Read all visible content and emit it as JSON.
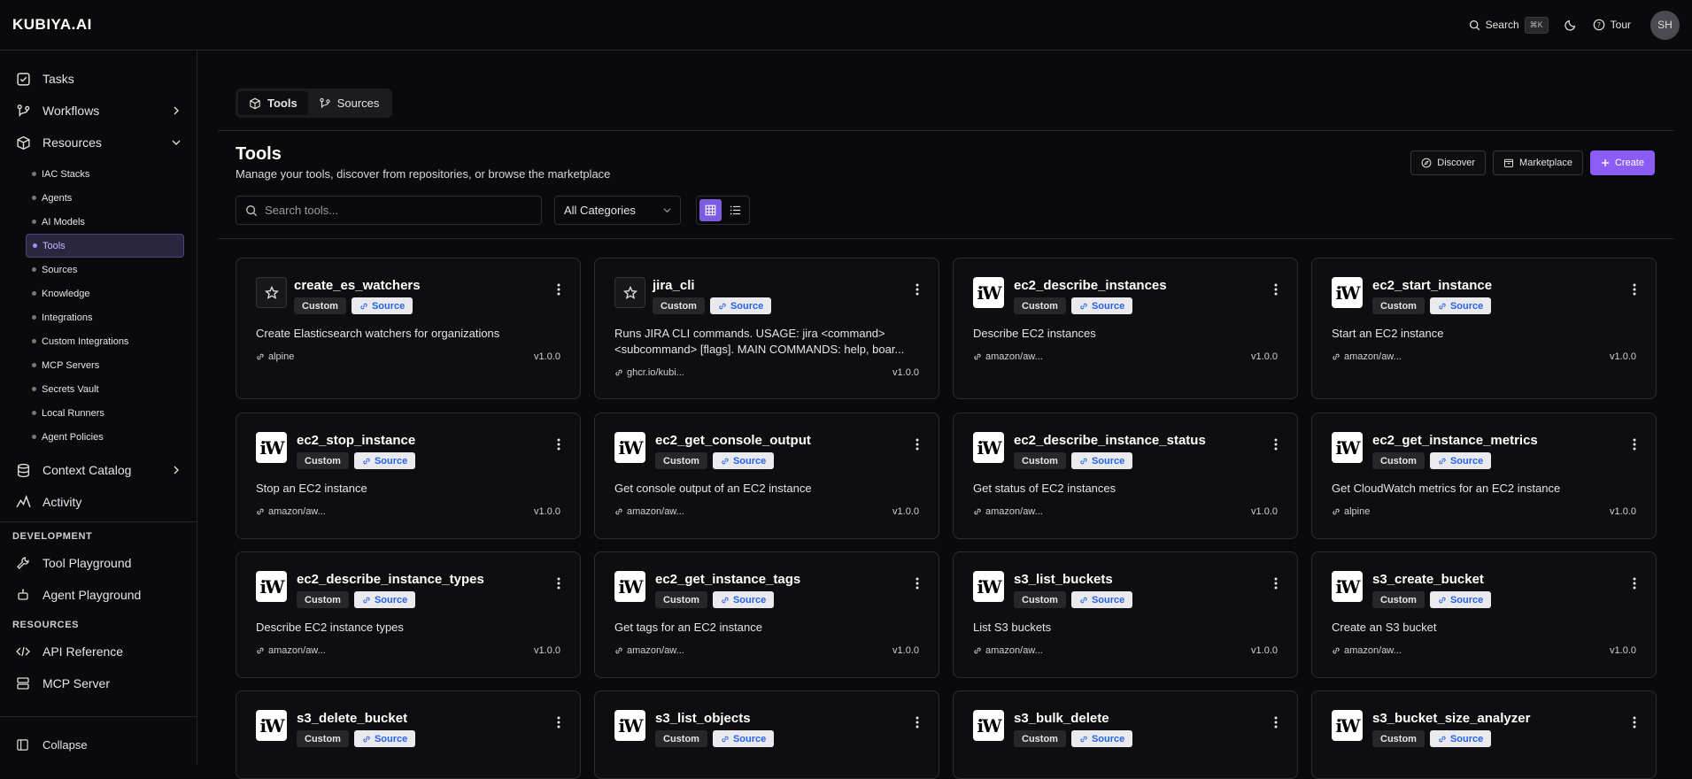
{
  "header": {
    "logo": "KUBIYA.AI",
    "search_label": "Search",
    "search_kbd": "⌘K",
    "tour_label": "Tour",
    "avatar": "SH"
  },
  "sidebar": {
    "tasks": "Tasks",
    "workflows": "Workflows",
    "resources": "Resources",
    "resource_items": [
      "IAC Stacks",
      "Agents",
      "AI Models",
      "Tools",
      "Sources",
      "Knowledge",
      "Integrations",
      "Custom Integrations",
      "MCP Servers",
      "Secrets Vault",
      "Local Runners",
      "Agent Policies"
    ],
    "context_catalog": "Context Catalog",
    "activity": "Activity",
    "dev_heading": "DEVELOPMENT",
    "tool_playground": "Tool Playground",
    "agent_playground": "Agent Playground",
    "res_heading": "RESOURCES",
    "api_reference": "API Reference",
    "mcp_server": "MCP Server",
    "collapse": "Collapse"
  },
  "main": {
    "tabs": {
      "tools": "Tools",
      "sources": "Sources"
    },
    "title": "Tools",
    "subtitle": "Manage your tools, discover from repositories, or browse the marketplace",
    "actions": {
      "discover": "Discover",
      "marketplace": "Marketplace",
      "create": "Create"
    },
    "search_placeholder": "Search tools...",
    "category": "All Categories"
  },
  "cards": [
    {
      "name": "create_es_watchers",
      "icon": "star-icon",
      "custom": "Custom",
      "source": "Source",
      "desc": "Create Elasticsearch watchers for organizations",
      "image": "alpine",
      "version": "v1.0.0"
    },
    {
      "name": "jira_cli",
      "icon": "star-icon",
      "custom": "Custom",
      "source": "Source",
      "desc": "Runs JIRA CLI commands. USAGE: jira <command> <subcommand> [flags]. MAIN COMMANDS: help, boar...",
      "image": "ghcr.io/kubi...",
      "version": "v1.0.0"
    },
    {
      "name": "ec2_describe_instances",
      "icon": "aws-icon",
      "custom": "Custom",
      "source": "Source",
      "desc": "Describe EC2 instances",
      "image": "amazon/aw...",
      "version": "v1.0.0"
    },
    {
      "name": "ec2_start_instance",
      "icon": "aws-icon",
      "custom": "Custom",
      "source": "Source",
      "desc": "Start an EC2 instance",
      "image": "amazon/aw...",
      "version": "v1.0.0"
    },
    {
      "name": "ec2_stop_instance",
      "icon": "aws-icon",
      "custom": "Custom",
      "source": "Source",
      "desc": "Stop an EC2 instance",
      "image": "amazon/aw...",
      "version": "v1.0.0"
    },
    {
      "name": "ec2_get_console_output",
      "icon": "aws-icon",
      "custom": "Custom",
      "source": "Source",
      "desc": "Get console output of an EC2 instance",
      "image": "amazon/aw...",
      "version": "v1.0.0"
    },
    {
      "name": "ec2_describe_instance_status",
      "icon": "aws-icon",
      "custom": "Custom",
      "source": "Source",
      "desc": "Get status of EC2 instances",
      "image": "amazon/aw...",
      "version": "v1.0.0"
    },
    {
      "name": "ec2_get_instance_metrics",
      "icon": "aws-icon",
      "custom": "Custom",
      "source": "Source",
      "desc": "Get CloudWatch metrics for an EC2 instance",
      "image": "alpine",
      "version": "v1.0.0"
    },
    {
      "name": "ec2_describe_instance_types",
      "icon": "aws-icon",
      "custom": "Custom",
      "source": "Source",
      "desc": "Describe EC2 instance types",
      "image": "amazon/aw...",
      "version": "v1.0.0"
    },
    {
      "name": "ec2_get_instance_tags",
      "icon": "aws-icon",
      "custom": "Custom",
      "source": "Source",
      "desc": "Get tags for an EC2 instance",
      "image": "amazon/aw...",
      "version": "v1.0.0"
    },
    {
      "name": "s3_list_buckets",
      "icon": "aws-icon",
      "custom": "Custom",
      "source": "Source",
      "desc": "List S3 buckets",
      "image": "amazon/aw...",
      "version": "v1.0.0"
    },
    {
      "name": "s3_create_bucket",
      "icon": "aws-icon",
      "custom": "Custom",
      "source": "Source",
      "desc": "Create an S3 bucket",
      "image": "amazon/aw...",
      "version": "v1.0.0"
    },
    {
      "name": "s3_delete_bucket",
      "icon": "aws-icon",
      "custom": "Custom",
      "source": "Source",
      "desc": "",
      "image": "",
      "version": ""
    },
    {
      "name": "s3_list_objects",
      "icon": "aws-icon",
      "custom": "Custom",
      "source": "Source",
      "desc": "",
      "image": "",
      "version": ""
    },
    {
      "name": "s3_bulk_delete",
      "icon": "aws-icon",
      "custom": "Custom",
      "source": "Source",
      "desc": "",
      "image": "",
      "version": ""
    },
    {
      "name": "s3_bucket_size_analyzer",
      "icon": "aws-icon",
      "custom": "Custom",
      "source": "Source",
      "desc": "",
      "image": "",
      "version": ""
    }
  ]
}
